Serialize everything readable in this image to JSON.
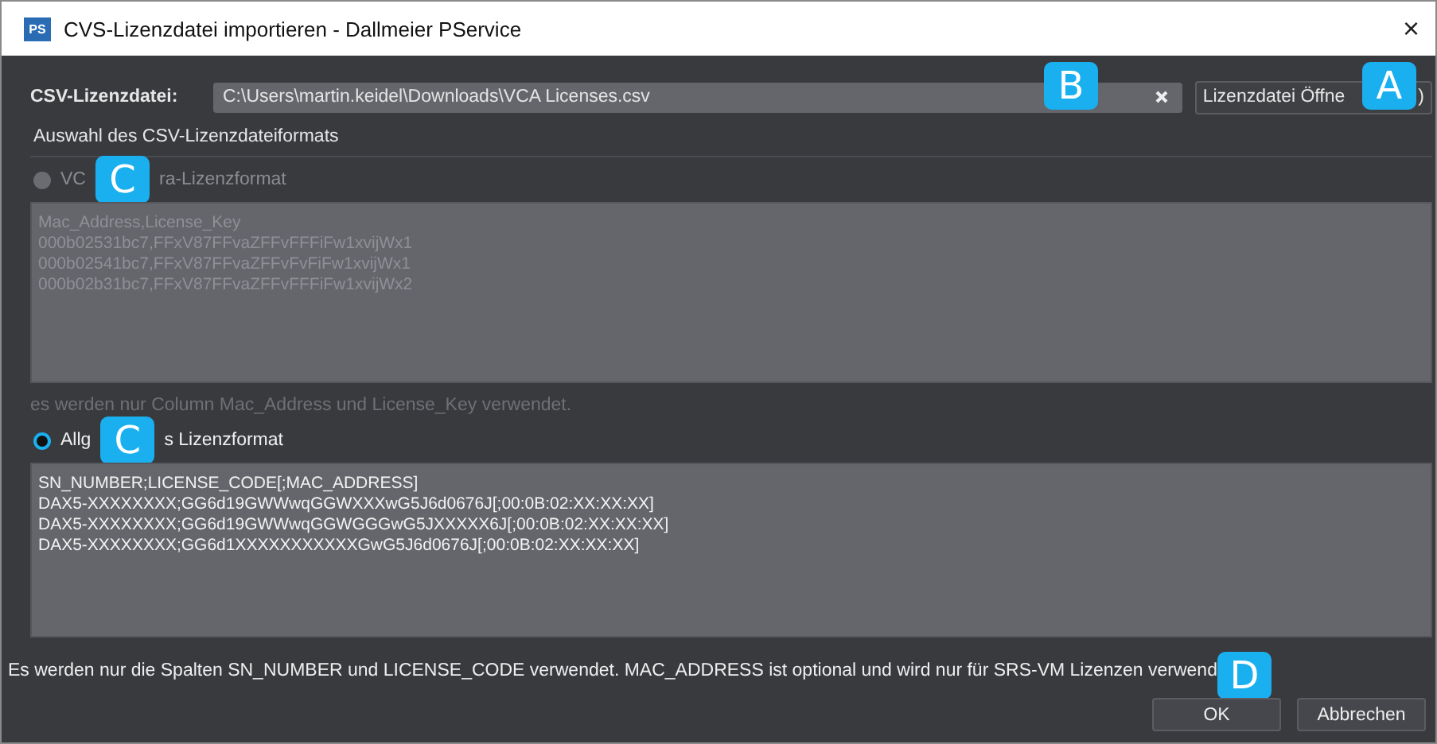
{
  "window": {
    "title": "CVS-Lizenzdatei importieren - Dallmeier PService",
    "app_icon": "PS",
    "close": "×"
  },
  "file": {
    "label": "CSV-Lizenzdatei:",
    "value": "C:\\Users\\martin.keidel\\Downloads\\VCA Licenses.csv",
    "field_callout": "B",
    "button_parts": [
      "Lizenzdatei Öffne",
      ")"
    ],
    "button_callout": "A"
  },
  "section_title": "Auswahl des CSV-Lizenzdateiformats",
  "formats": [
    {
      "label_parts": [
        "VC",
        "ra-Lizenzformat"
      ],
      "callout": "C",
      "selected": false,
      "disabled": true,
      "sample": [
        "Mac_Address,License_Key",
        "000b02531bc7,FFxV87FFvaZFFvFFFiFw1xvijWx1",
        "000b02541bc7,FFxV87FFvaZFFvFvFiFw1xvijWx1",
        "000b02b31bc7,FFxV87FFvaZFFvFFFiFw1xvijWx2"
      ],
      "hint": "es werden nur Column Mac_Address und License_Key verwendet."
    },
    {
      "label_parts": [
        "Allg",
        "s Lizenzformat"
      ],
      "callout": "C",
      "selected": true,
      "disabled": false,
      "sample": [
        "SN_NUMBER;LICENSE_CODE[;MAC_ADDRESS]",
        "DAX5-XXXXXXXX;GG6d19GWWwqGGWXXXwG5J6d0676J[;00:0B:02:XX:XX:XX]",
        "DAX5-XXXXXXXX;GG6d19GWWwqGGWGGGwG5JXXXXX6J[;00:0B:02:XX:XX:XX]",
        "DAX5-XXXXXXXX;GG6d1XXXXXXXXXXXGwG5J6d0676J[;00:0B:02:XX:XX:XX]"
      ]
    }
  ],
  "note": "Es werden nur die Spalten SN_NUMBER und LICENSE_CODE verwendet. MAC_ADDRESS ist optional und wird nur für SRS-VM Lizenzen verwend",
  "note_callout": "D",
  "buttons": [
    "OK",
    "Abbrechen"
  ]
}
